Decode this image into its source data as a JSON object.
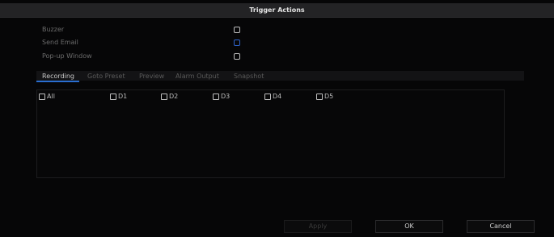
{
  "dialog": {
    "title": "Trigger Actions"
  },
  "options": [
    {
      "label": "Buzzer",
      "checked": false
    },
    {
      "label": "Send Email",
      "checked": false
    },
    {
      "label": "Pop-up Window",
      "checked": false
    }
  ],
  "tabs": [
    {
      "label": "Recording",
      "active": true
    },
    {
      "label": "Goto Preset",
      "active": false
    },
    {
      "label": "Preview",
      "active": false
    },
    {
      "label": "Alarm Output",
      "active": false
    },
    {
      "label": "Snapshot",
      "active": false
    }
  ],
  "channels": [
    {
      "label": "All",
      "checked": false
    },
    {
      "label": "D1",
      "checked": false
    },
    {
      "label": "D2",
      "checked": false
    },
    {
      "label": "D3",
      "checked": false
    },
    {
      "label": "D4",
      "checked": false
    },
    {
      "label": "D5",
      "checked": false
    }
  ],
  "buttons": {
    "apply": {
      "label": "Apply",
      "enabled": false
    },
    "ok": {
      "label": "OK",
      "enabled": true
    },
    "cancel": {
      "label": "Cancel",
      "enabled": true
    }
  },
  "colors": {
    "accent": "#2a6ed0",
    "focus_checkbox": "#2f63c9",
    "titlebar": "#232325"
  }
}
